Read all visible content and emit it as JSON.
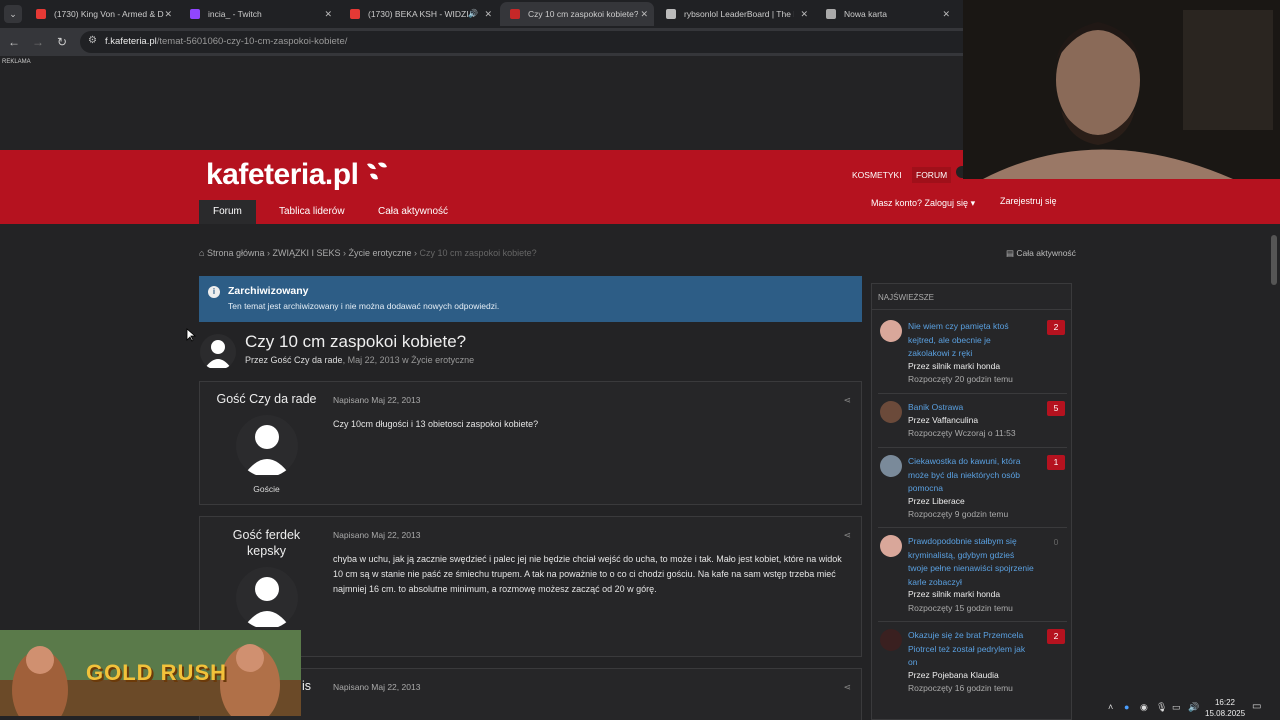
{
  "browser": {
    "tabs": [
      {
        "title": "(1730) King Von - Armed & Da",
        "favicon_color": "#e53935",
        "extra": "",
        "active": false
      },
      {
        "title": "incia_ - Twitch",
        "favicon_color": "#9146ff",
        "extra": "",
        "active": false
      },
      {
        "title": "(1730) BEKA KSH - WIDZIA",
        "favicon_color": "#e53935",
        "extra": "🔊",
        "active": false
      },
      {
        "title": "Czy 10 cm zaspokoi kobiete? -",
        "favicon_color": "#c62828",
        "extra": "",
        "active": true
      },
      {
        "title": "rybsonlol LeaderBoard | The be",
        "favicon_color": "#bbbbbb",
        "extra": "",
        "active": false
      },
      {
        "title": "Nowa karta",
        "favicon_color": "#aaaaaa",
        "extra": "",
        "active": false
      }
    ],
    "url_host": "f.kafeteria.pl",
    "url_path": "/temat-5601060-czy-10-cm-zaspokoi-kobiete/"
  },
  "ad_label": "REKLAMA",
  "header": {
    "logo": "kafeteria.pl",
    "links": {
      "kosmetyki": "KOSMETYKI",
      "forum": "FORUM"
    },
    "tabs": [
      "Forum",
      "Tablica liderów",
      "Cała aktywność"
    ],
    "login": "Masz konto? Zaloguj się",
    "register": "Zarejestruj się"
  },
  "breadcrumb": {
    "items": [
      "Strona główna",
      "ZWIĄZKI I SEKS",
      "Życie erotyczne"
    ],
    "current": "Czy 10 cm zaspokoi kobiete?",
    "activity": "Cała aktywność"
  },
  "notice": {
    "title": "Zarchiwizowany",
    "text": "Ten temat jest archiwizowany i nie można dodawać nowych odpowiedzi."
  },
  "topic": {
    "title": "Czy 10 cm zaspokoi kobiete?",
    "by_prefix": "Przez",
    "author": "Gość Czy da rade",
    "date": "Maj 22, 2013",
    "in_prefix": "w",
    "category": "Życie erotyczne"
  },
  "posts": [
    {
      "author": "Gość Czy da rade",
      "role": "Goście",
      "date": "Napisano Maj 22, 2013",
      "body": "Czy 10cm długości i 13 obietosci zaspokoi kobiete?"
    },
    {
      "author": "Gość ferdek kepsky",
      "role": "",
      "date": "Napisano Maj 22, 2013",
      "body": "chyba w uchu, jak ją zacznie swędzieć i palec jej nie będzie chciał wejść do ucha, to może i tak. Mało jest kobiet, które na widok 10 cm są w stanie nie paść ze śmiechu trupem. A tak na poważnie to o co ci chodzi gościu. Na kafe na sam wstęp trzeba mieć najmniej 16 cm. to absolutne minimum, a rozmowę możesz zacząć od 20 w górę."
    },
    {
      "author": "is",
      "role": "",
      "date": "Napisano Maj 22, 2013",
      "body": ""
    }
  ],
  "sidebar": {
    "heading": "NAJŚWIEŻSZE",
    "items": [
      {
        "title": "Nie wiem czy pamięta ktoś kejtred, ale obecnie je zakolakowi z ręki",
        "by": "Przez silnik marki honda",
        "started": "Rozpoczęty 20 godzin temu",
        "count": "2",
        "avatar_color": "#d9a79a"
      },
      {
        "title": "Banik Ostrawa",
        "by": "Przez Vaffanculina",
        "started": "Rozpoczęty Wczoraj o 11:53",
        "count": "5",
        "avatar_color": "#6b4a3a"
      },
      {
        "title": "Ciekawostka do kawuni, która może być dla niektórych osób pomocna",
        "by": "Przez Liberace",
        "started": "Rozpoczęty 9 godzin temu",
        "count": "1",
        "avatar_color": "#7a8a9a"
      },
      {
        "title": "Prawdopodobnie stałbym się kryminalistą, gdybym gdzieś twoje pełne nienawiści spojrzenie karle zobaczył",
        "by": "Przez silnik marki honda",
        "started": "Rozpoczęty 15 godzin temu",
        "count": "0",
        "avatar_color": "#d9a79a"
      },
      {
        "title": "Okazuje się że brat Przemcela Piotrcel też został pedrylem jak on",
        "by": "Przez Pojebana Klaudia",
        "started": "Rozpoczęty 16 godzin temu",
        "count": "2",
        "avatar_color": "#3a2020"
      }
    ]
  },
  "overlay": {
    "game_title": "GOLD RUSH"
  },
  "system": {
    "time": "16:22",
    "date": "15.08.2025"
  }
}
